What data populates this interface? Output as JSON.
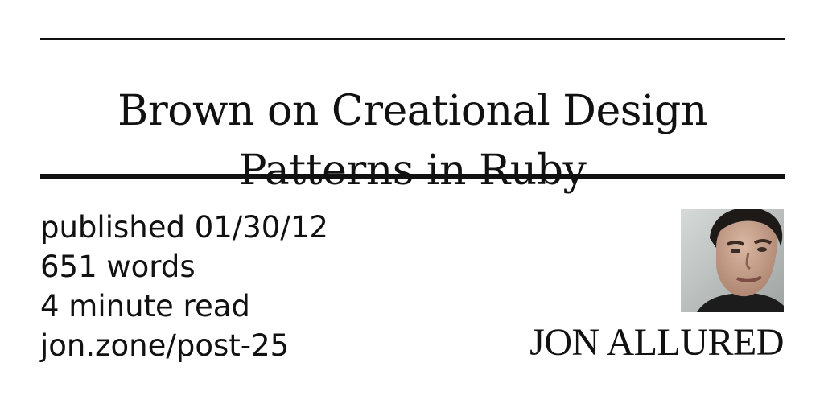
{
  "title": {
    "line1": "Brown on Creational Design",
    "line2": "Patterns in Ruby"
  },
  "meta": {
    "published": "published 01/30/12",
    "words": "651 words",
    "read_time": "4 minute read",
    "url": "jon.zone/post-25"
  },
  "author": {
    "name": "JON ALLURED",
    "photo_icon": "author-portrait"
  }
}
